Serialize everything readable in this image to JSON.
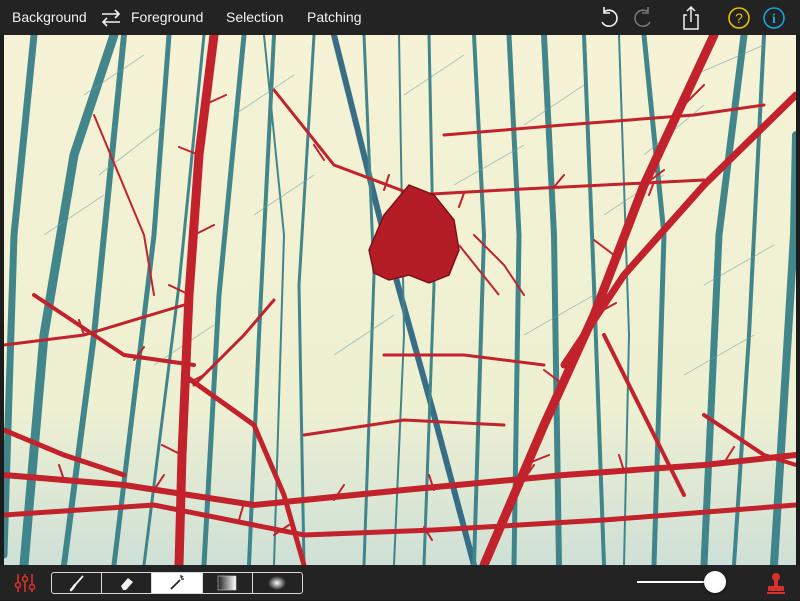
{
  "toolbar": {
    "background_label": "Background",
    "foreground_label": "Foreground",
    "selection_label": "Selection",
    "patching_label": "Patching",
    "icons": [
      "swap-icon",
      "undo-icon",
      "redo-icon",
      "share-icon",
      "help-icon",
      "info-icon"
    ]
  },
  "colors": {
    "bar": "#232323",
    "accent_red": "#d9302b",
    "help_yellow": "#e5c100",
    "info_blue": "#18a3e0",
    "canvas_sky": "#f7f3d8",
    "tree_teal": "#2f7b83",
    "branch_red": "#c2222b"
  },
  "bottom_bar": {
    "tools": [
      "brush-icon",
      "eraser-icon",
      "magic-wand-icon",
      "gradient-icon",
      "radial-gradient-icon"
    ],
    "active_tool_index": 2,
    "slider_value": 1.0,
    "left_icon": "adjustments-icon",
    "right_icon": "stamp-icon"
  }
}
